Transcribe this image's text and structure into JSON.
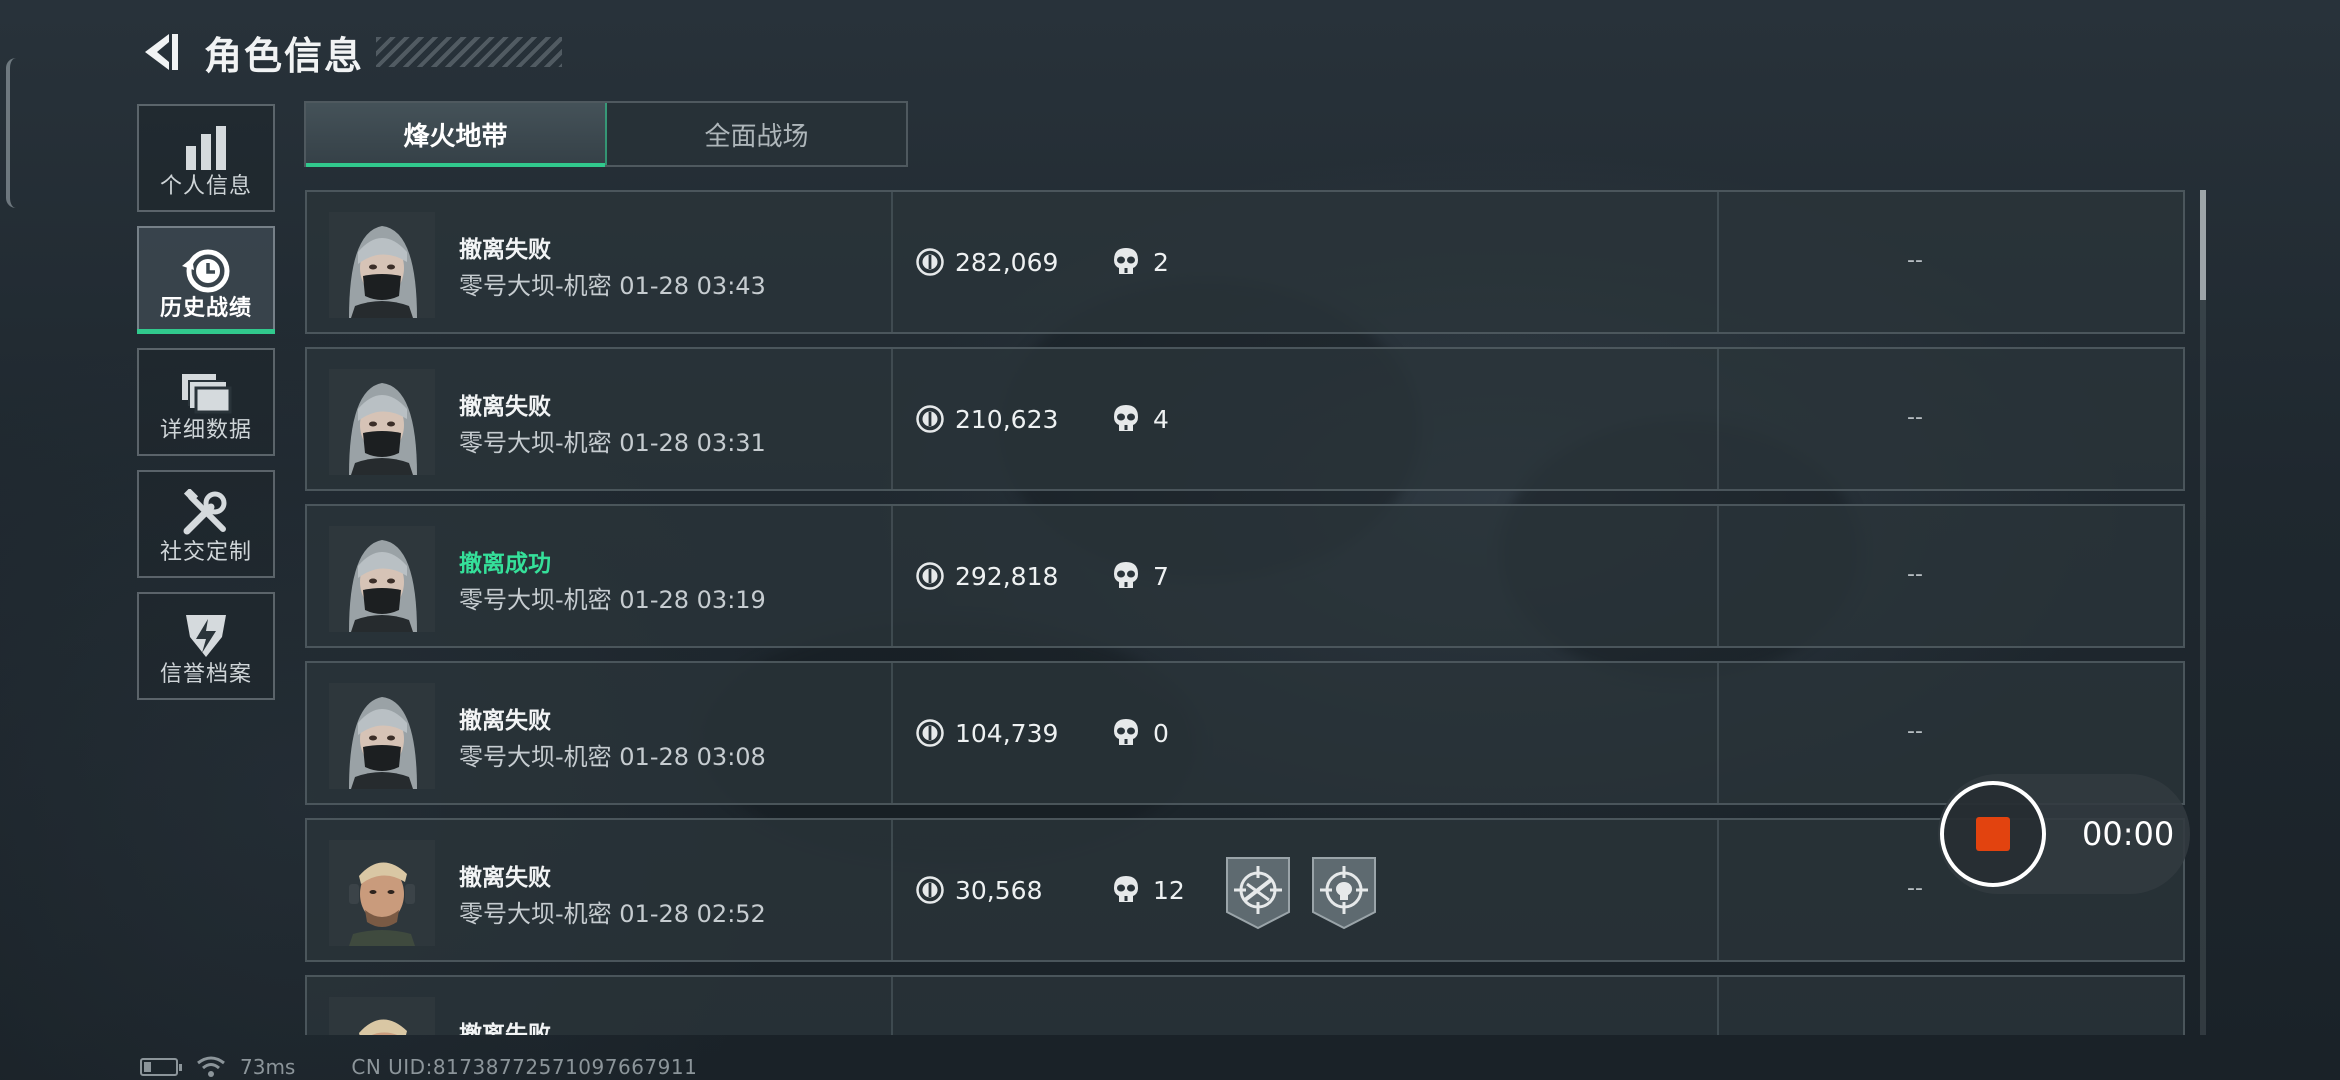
{
  "header": {
    "title": "角色信息"
  },
  "sidebar": {
    "items": [
      {
        "label": "个人信息",
        "icon": "bar-chart-icon"
      },
      {
        "label": "历史战绩",
        "icon": "history-clock-icon",
        "active": true
      },
      {
        "label": "详细数据",
        "icon": "stacked-cards-icon"
      },
      {
        "label": "社交定制",
        "icon": "wrench-screwdriver-icon"
      },
      {
        "label": "信誉档案",
        "icon": "shield-lightning-icon"
      }
    ]
  },
  "tabs": [
    {
      "label": "烽火地带",
      "active": true
    },
    {
      "label": "全面战场"
    }
  ],
  "records": [
    {
      "status": "撤离失败",
      "success": false,
      "meta": "零号大坝-机密 01-28 03:43",
      "value": "282,069",
      "kills": "2",
      "badges": [],
      "extra": "--",
      "avatar": "female-operator-avatar"
    },
    {
      "status": "撤离失败",
      "success": false,
      "meta": "零号大坝-机密 01-28 03:31",
      "value": "210,623",
      "kills": "4",
      "badges": [],
      "extra": "--",
      "avatar": "female-operator-avatar"
    },
    {
      "status": "撤离成功",
      "success": true,
      "meta": "零号大坝-机密 01-28 03:19",
      "value": "292,818",
      "kills": "7",
      "badges": [],
      "extra": "--",
      "avatar": "female-operator-avatar"
    },
    {
      "status": "撤离失败",
      "success": false,
      "meta": "零号大坝-机密 01-28 03:08",
      "value": "104,739",
      "kills": "0",
      "badges": [],
      "extra": "--",
      "avatar": "female-operator-avatar"
    },
    {
      "status": "撤离失败",
      "success": false,
      "meta": "零号大坝-机密 01-28 02:52",
      "value": "30,568",
      "kills": "12",
      "badges": [
        "crosshair-rifle-badge",
        "crosshair-skull-badge"
      ],
      "extra": "--",
      "avatar": "male-operator-avatar"
    },
    {
      "status": "撤离失败",
      "success": false,
      "meta": "",
      "value": "",
      "kills": "",
      "badges": [],
      "extra": "",
      "avatar": "male-operator-avatar"
    }
  ],
  "recorder": {
    "time": "00:00"
  },
  "statusbar": {
    "ping": "73ms",
    "uid": "CN UID:81738772571097667911"
  },
  "colors": {
    "accent_green": "#31c98d",
    "success_text": "#35e09a",
    "record_red": "#e2430f"
  }
}
